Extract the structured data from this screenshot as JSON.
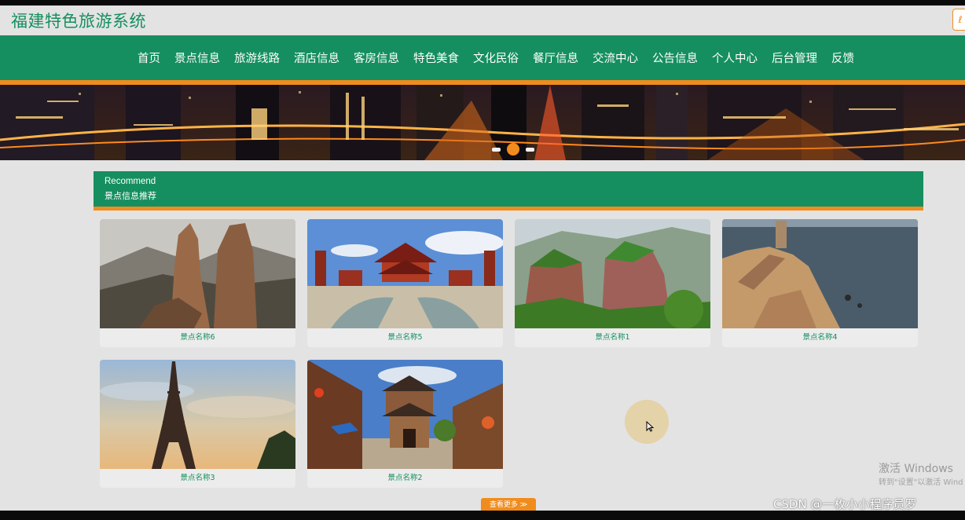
{
  "site": {
    "title": "福建特色旅游系统",
    "corner_label": "ℓ"
  },
  "nav": {
    "items": [
      "首页",
      "景点信息",
      "旅游线路",
      "酒店信息",
      "客房信息",
      "特色美食",
      "文化民俗",
      "餐厅信息",
      "交流中心",
      "公告信息",
      "个人中心",
      "后台管理",
      "反馈"
    ]
  },
  "banner": {
    "slide_count": 3,
    "active_slide": 2
  },
  "section": {
    "en": "Recommend",
    "zh": "景点信息推荐"
  },
  "cards": [
    {
      "caption": "景点名称6",
      "scene": "rock-peaks"
    },
    {
      "caption": "景点名称5",
      "scene": "temple"
    },
    {
      "caption": "景点名称1",
      "scene": "green-cliffs"
    },
    {
      "caption": "景点名称4",
      "scene": "sea-cliff"
    },
    {
      "caption": "景点名称3",
      "scene": "eiffel-tower"
    },
    {
      "caption": "景点名称2",
      "scene": "old-town"
    }
  ],
  "more_button": {
    "label": "查看更多 ≫"
  },
  "watermark": {
    "line1": "激活 Windows",
    "line2": "转到\"设置\"以激活 Wind",
    "csdn": "CSDN @一枚小小程序员罗"
  },
  "colors": {
    "primary": "#158f5f",
    "accent": "#f08c1e",
    "background": "#e3e3e3"
  }
}
